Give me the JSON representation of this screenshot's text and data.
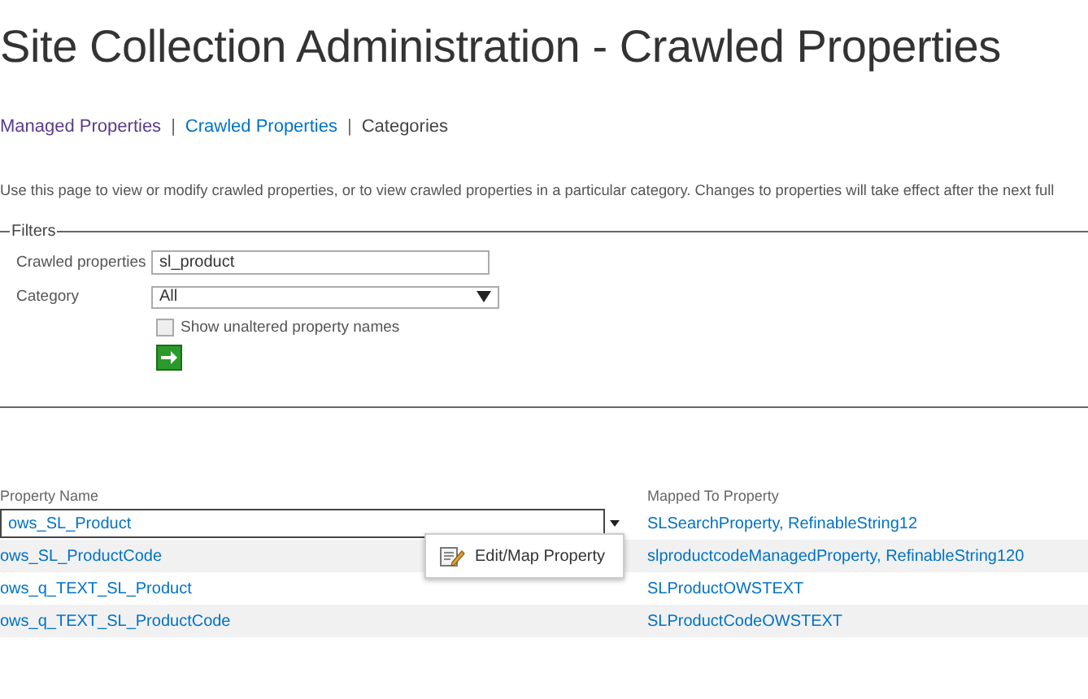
{
  "page_title": "Site Collection Administration - Crawled Properties",
  "nav_separator": "|",
  "nav_links": [
    {
      "label": "Managed Properties",
      "kind": "visited"
    },
    {
      "label": "Crawled Properties",
      "kind": "link"
    },
    {
      "label": "Categories",
      "kind": "current"
    }
  ],
  "description": "Use this page to view or modify crawled properties, or to view crawled properties in a particular category. Changes to properties will take effect after the next full",
  "filters": {
    "legend": "Filters",
    "crawled_properties_label": "Crawled properties",
    "crawled_properties_value": "sl_product",
    "category_label": "Category",
    "category_value": "All",
    "show_unaltered_label": "Show unaltered property names",
    "show_unaltered_checked": false
  },
  "table": {
    "columns": [
      "Property Name",
      "Mapped To Property"
    ],
    "rows": [
      {
        "name": "ows_SL_Product",
        "mapped": "SLSearchProperty, RefinableString12",
        "selected": true
      },
      {
        "name": "ows_SL_ProductCode",
        "mapped": "slproductcodeManagedProperty, RefinableString120",
        "selected": false
      },
      {
        "name": "ows_q_TEXT_SL_Product",
        "mapped": "SLProductOWSTEXT",
        "selected": false
      },
      {
        "name": "ows_q_TEXT_SL_ProductCode",
        "mapped": "SLProductCodeOWSTEXT",
        "selected": false
      }
    ]
  },
  "context_menu": {
    "items": [
      "Edit/Map Property"
    ]
  }
}
